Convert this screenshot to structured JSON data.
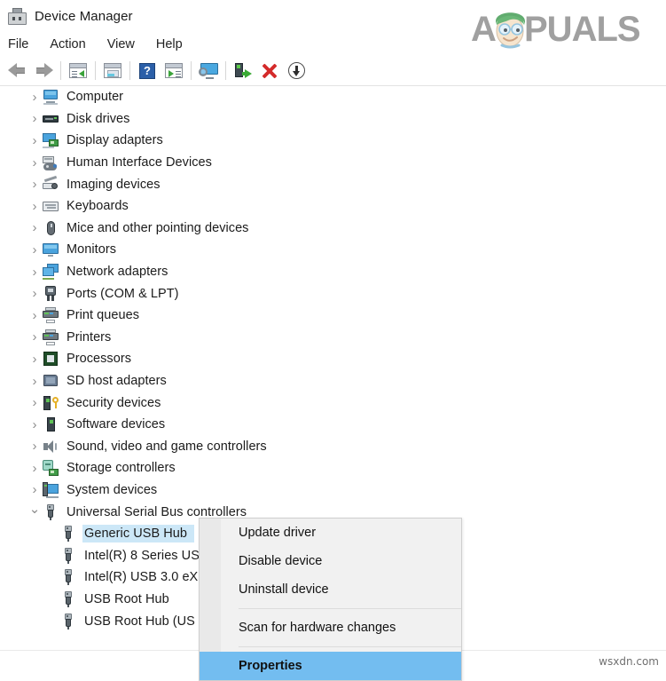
{
  "window": {
    "title": "Device Manager",
    "icon": "device-manager-icon"
  },
  "menubar": {
    "items": [
      {
        "label": "File",
        "name": "menu-file"
      },
      {
        "label": "Action",
        "name": "menu-action"
      },
      {
        "label": "View",
        "name": "menu-view"
      },
      {
        "label": "Help",
        "name": "menu-help"
      }
    ]
  },
  "toolbar": {
    "buttons": [
      {
        "icon": "back-arrow-icon",
        "label": "Back"
      },
      {
        "icon": "forward-arrow-icon",
        "label": "Forward"
      },
      {
        "icon": "show-hide-console-tree-icon",
        "label": "Show/Hide Console Tree"
      },
      {
        "icon": "properties-icon",
        "label": "Properties"
      },
      {
        "icon": "help-icon",
        "label": "Help"
      },
      {
        "icon": "show-hide-action-pane-icon",
        "label": "Show/Hide Action Pane"
      },
      {
        "icon": "update-driver-monitor-icon",
        "label": "Update Driver"
      },
      {
        "icon": "uninstall-device-icon",
        "label": "Uninstall Device"
      },
      {
        "icon": "disable-device-icon",
        "label": "Disable Device"
      },
      {
        "icon": "scan-hardware-changes-icon",
        "label": "Scan for hardware changes"
      }
    ]
  },
  "tree": {
    "items": [
      {
        "label": "Computer",
        "icon": "computer-icon",
        "expanded": false,
        "level": 1
      },
      {
        "label": "Disk drives",
        "icon": "disk-drive-icon",
        "expanded": false,
        "level": 1
      },
      {
        "label": "Display adapters",
        "icon": "display-adapter-icon",
        "expanded": false,
        "level": 1
      },
      {
        "label": "Human Interface Devices",
        "icon": "human-interface-device-icon",
        "expanded": false,
        "level": 1
      },
      {
        "label": "Imaging devices",
        "icon": "imaging-device-icon",
        "expanded": false,
        "level": 1
      },
      {
        "label": "Keyboards",
        "icon": "keyboard-icon",
        "expanded": false,
        "level": 1
      },
      {
        "label": "Mice and other pointing devices",
        "icon": "mouse-icon",
        "expanded": false,
        "level": 1
      },
      {
        "label": "Monitors",
        "icon": "monitor-icon",
        "expanded": false,
        "level": 1
      },
      {
        "label": "Network adapters",
        "icon": "network-adapter-icon",
        "expanded": false,
        "level": 1
      },
      {
        "label": "Ports (COM & LPT)",
        "icon": "port-icon",
        "expanded": false,
        "level": 1
      },
      {
        "label": "Print queues",
        "icon": "print-queue-icon",
        "expanded": false,
        "level": 1
      },
      {
        "label": "Printers",
        "icon": "printer-icon",
        "expanded": false,
        "level": 1
      },
      {
        "label": "Processors",
        "icon": "processor-icon",
        "expanded": false,
        "level": 1
      },
      {
        "label": "SD host adapters",
        "icon": "sd-host-adapter-icon",
        "expanded": false,
        "level": 1
      },
      {
        "label": "Security devices",
        "icon": "security-device-icon",
        "expanded": false,
        "level": 1
      },
      {
        "label": "Software devices",
        "icon": "software-device-icon",
        "expanded": false,
        "level": 1
      },
      {
        "label": "Sound, video and game controllers",
        "icon": "sound-device-icon",
        "expanded": false,
        "level": 1
      },
      {
        "label": "Storage controllers",
        "icon": "storage-controller-icon",
        "expanded": false,
        "level": 1
      },
      {
        "label": "System devices",
        "icon": "system-device-icon",
        "expanded": false,
        "level": 1
      },
      {
        "label": "Universal Serial Bus controllers",
        "icon": "usb-controller-icon",
        "expanded": true,
        "level": 1
      },
      {
        "label": "Generic USB Hub",
        "icon": "usb-device-icon",
        "level": 2,
        "selected": true
      },
      {
        "label": "Intel(R) 8 Series US",
        "icon": "usb-device-icon",
        "level": 2,
        "selected": false
      },
      {
        "label": "Intel(R) USB 3.0 eX",
        "icon": "usb-device-icon",
        "level": 2,
        "selected": false
      },
      {
        "label": "USB Root Hub",
        "icon": "usb-device-icon",
        "level": 2,
        "selected": false
      },
      {
        "label": "USB Root Hub (US",
        "icon": "usb-device-icon",
        "level": 2,
        "selected": false
      }
    ],
    "selection_color": "#cce7f7"
  },
  "context_menu": {
    "items": [
      {
        "label": "Update driver",
        "type": "item",
        "highlighted": false
      },
      {
        "label": "Disable device",
        "type": "item",
        "highlighted": false
      },
      {
        "label": "Uninstall device",
        "type": "item",
        "highlighted": false
      },
      {
        "type": "separator"
      },
      {
        "label": "Scan for hardware changes",
        "type": "item",
        "highlighted": false
      },
      {
        "type": "separator"
      },
      {
        "label": "Properties",
        "type": "item",
        "highlighted": true
      }
    ],
    "highlight_color": "#73bdf0"
  },
  "watermarks": {
    "brand": "APPUALS",
    "brand_color": "#8c8c8c",
    "hair_color": "#4aa85a",
    "site": "wsxdn.com"
  }
}
